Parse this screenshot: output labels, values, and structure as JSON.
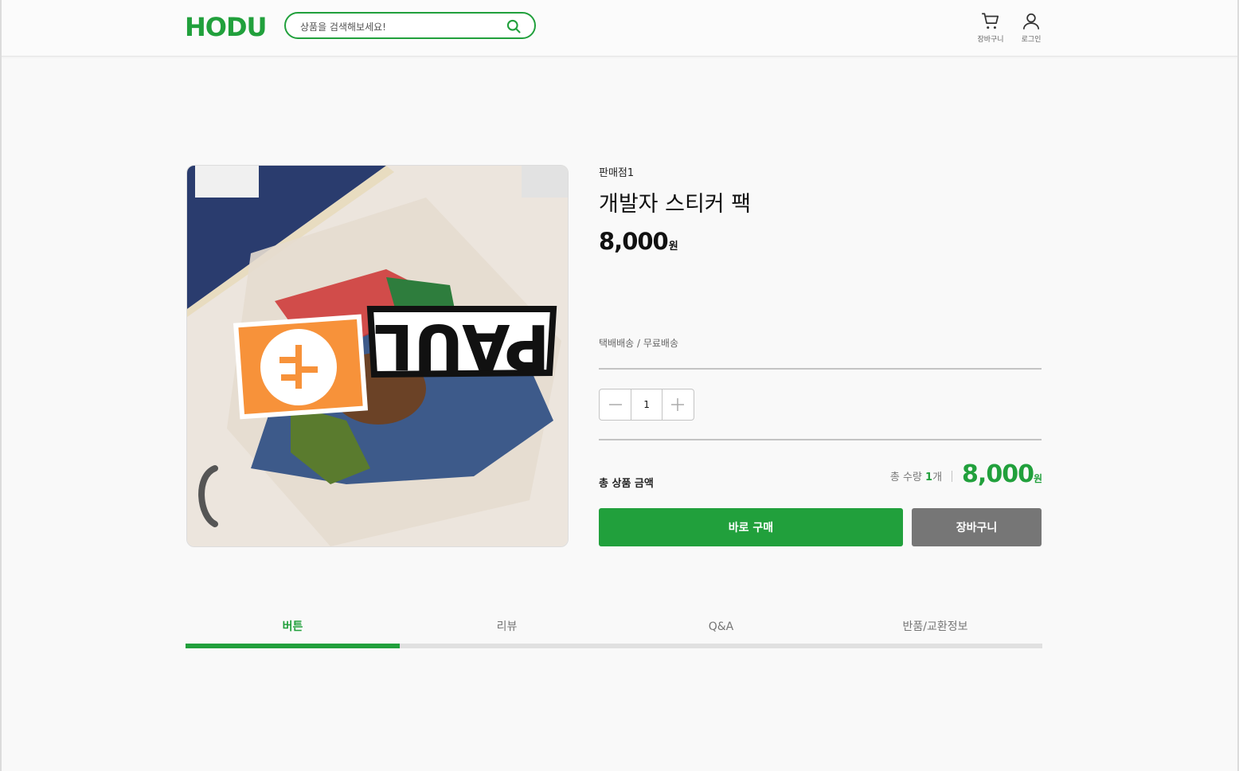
{
  "header": {
    "logo": "HODU",
    "search_placeholder": "상품을 검색해보세요!",
    "cart_label": "장바구니",
    "login_label": "로그인"
  },
  "product": {
    "image_text": "PAUL",
    "seller": "판매점1",
    "name": "개발자 스티커 팩",
    "price": "8,000",
    "price_unit": "원",
    "shipping": "택배배송 / 무료배송",
    "quantity": "1",
    "total_label": "총 상품 금액",
    "total_qty_prefix": "총 수량",
    "total_qty_value": "1",
    "total_qty_unit": "개",
    "total_price": "8,000",
    "total_price_unit": "원",
    "buy_label": "바로 구매",
    "cart_label": "장바구니"
  },
  "tabs": [
    {
      "label": "버튼",
      "active": true
    },
    {
      "label": "리뷰",
      "active": false
    },
    {
      "label": "Q&A",
      "active": false
    },
    {
      "label": "반품/교환정보",
      "active": false
    }
  ],
  "colors": {
    "accent": "#21a03c",
    "secondary_button": "#767676",
    "background": "#f9f9f9"
  }
}
